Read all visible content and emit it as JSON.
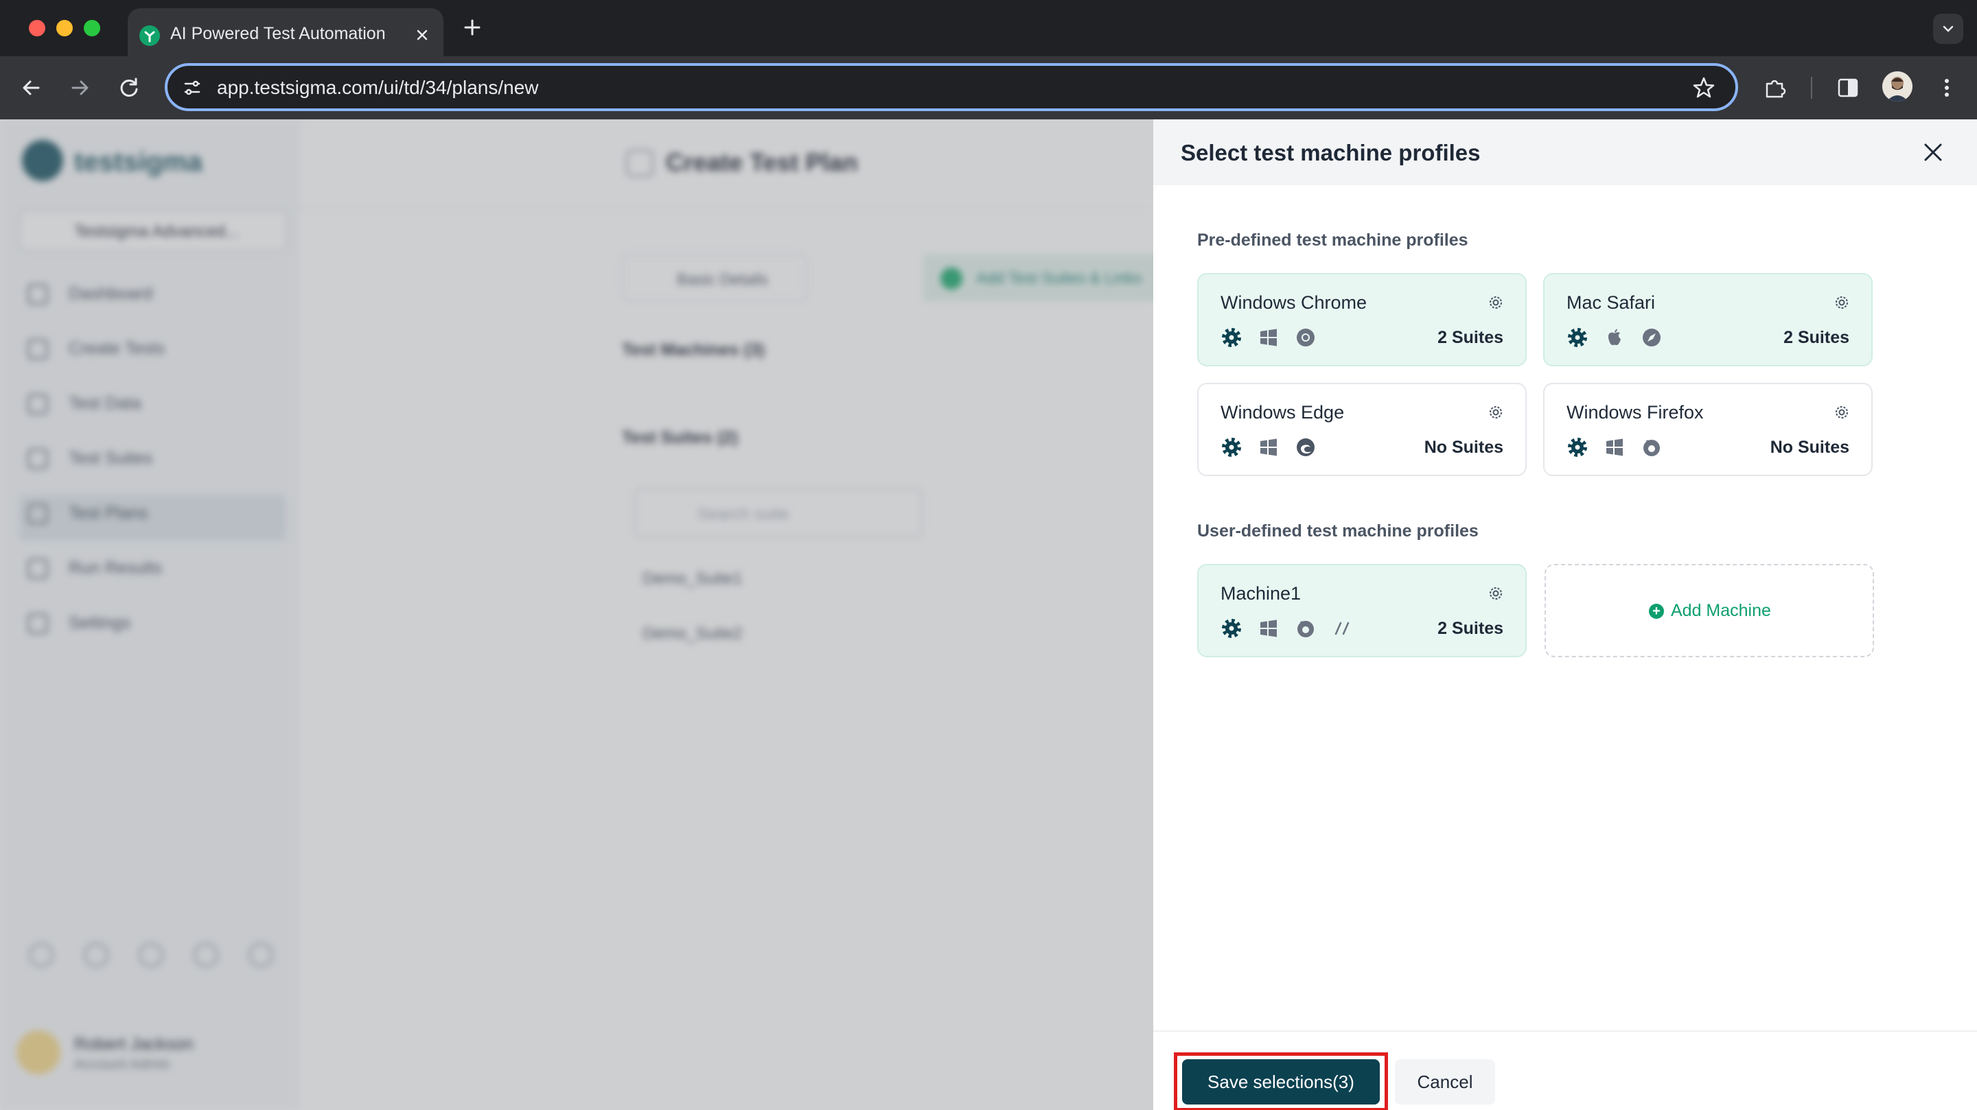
{
  "browser": {
    "tab_title": "AI Powered Test Automation",
    "url": "app.testsigma.com/ui/td/34/plans/new"
  },
  "background_app": {
    "logo_text": "testsigma",
    "workspace": "Testsigma Advanced...",
    "nav": [
      "Dashboard",
      "Create Tests",
      "Test Data",
      "Test Suites",
      "Test Plans",
      "Run Results",
      "Settings"
    ],
    "page_title": "Create Test Plan",
    "steps": [
      "Basic Details",
      "Add Test Suites & Links"
    ],
    "test_machines_label": "Test Machines (3)",
    "test_suites_label": "Test Suites (2)",
    "search_placeholder": "Search suite",
    "suites": [
      "Demo_Suite1",
      "Demo_Suite2"
    ],
    "user_name": "Robert Jackson",
    "user_role": "Account Admin"
  },
  "drawer": {
    "title": "Select test machine profiles",
    "predefined_label": "Pre-defined test machine profiles",
    "userdefined_label": "User-defined test machine profiles",
    "predefined": [
      {
        "name": "Windows Chrome",
        "suites": "2 Suites",
        "selected": true,
        "icons": [
          "settings-icon",
          "windows-icon",
          "chrome-icon"
        ]
      },
      {
        "name": "Mac Safari",
        "suites": "2 Suites",
        "selected": true,
        "icons": [
          "settings-icon",
          "apple-icon",
          "safari-icon"
        ]
      },
      {
        "name": "Windows Edge",
        "suites": "No Suites",
        "selected": false,
        "icons": [
          "settings-icon",
          "windows-icon",
          "edge-icon"
        ]
      },
      {
        "name": "Windows Firefox",
        "suites": "No Suites",
        "selected": false,
        "icons": [
          "settings-icon",
          "windows-icon",
          "firefox-icon"
        ]
      }
    ],
    "userdefined": [
      {
        "name": "Machine1",
        "suites": "2 Suites",
        "selected": true,
        "icons": [
          "settings-icon",
          "windows-icon",
          "firefox-icon",
          "slash-icon"
        ]
      }
    ],
    "add_machine": "Add Machine",
    "save_button": "Save selections(3)",
    "cancel_button": "Cancel"
  },
  "colors": {
    "accent_dark": "#0c4150",
    "selected_card_bg": "#e8f7f2",
    "add_green": "#0e9f6e",
    "highlight_red": "#e01e1e"
  }
}
